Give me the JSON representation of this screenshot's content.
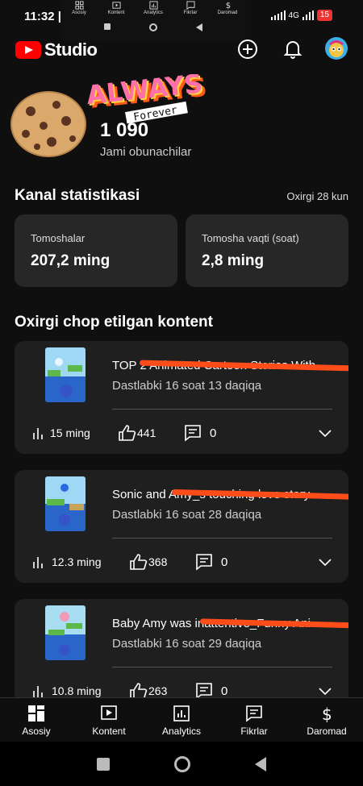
{
  "status": {
    "time": "11:32 |",
    "network": "4G",
    "battery": "15"
  },
  "overlay": {
    "items": [
      {
        "label": "Asosiy",
        "icon": "grid-icon"
      },
      {
        "label": "Kontent",
        "icon": "video-icon"
      },
      {
        "label": "Analytics",
        "icon": "chart-icon"
      },
      {
        "label": "Fikrlar",
        "icon": "comment-icon"
      },
      {
        "label": "Daromad",
        "icon": "dollar-icon"
      }
    ]
  },
  "header": {
    "logo_text": "Studio"
  },
  "channel": {
    "banner_word": "ALWAYS",
    "banner_sub": "Forever",
    "subscriber_count": "1 090",
    "subscriber_label": "Jami obunachilar"
  },
  "stats": {
    "title": "Kanal statistikasi",
    "period": "Oxirgi 28 kun",
    "cards": [
      {
        "label": "Tomoshalar",
        "value": "207,2 ming"
      },
      {
        "label": "Tomosha vaqti (soat)",
        "value": "2,8 ming"
      }
    ]
  },
  "content": {
    "title": "Oxirgi chop etilgan kontent",
    "items": [
      {
        "title": "TOP 2 Animated Cartoon Stories With",
        "subtitle": "Dastlabki 16 soat 13 daqiqa",
        "views": "15 ming",
        "likes": "441",
        "comments": "0"
      },
      {
        "title": "Sonic and Amy_s touching love story",
        "subtitle": "Dastlabki 16 soat 28 daqiqa",
        "views": "12.3 ming",
        "likes": "368",
        "comments": "0"
      },
      {
        "title": "Baby Amy was inattentive_Funny Ani",
        "subtitle": "Dastlabki 16 soat 29 daqiqa",
        "views": "10.8 ming",
        "likes": "263",
        "comments": "0"
      }
    ]
  },
  "bottom_nav": [
    {
      "label": "Asosiy",
      "icon": "dashboard-icon"
    },
    {
      "label": "Kontent",
      "icon": "content-icon"
    },
    {
      "label": "Analytics",
      "icon": "analytics-icon"
    },
    {
      "label": "Fikrlar",
      "icon": "comments-icon"
    },
    {
      "label": "Daromad",
      "icon": "earn-icon"
    }
  ],
  "colors": {
    "background": "#0f0f0f",
    "card": "#272727",
    "brand_red": "#ff0000",
    "scribble": "#ff4d1a"
  }
}
